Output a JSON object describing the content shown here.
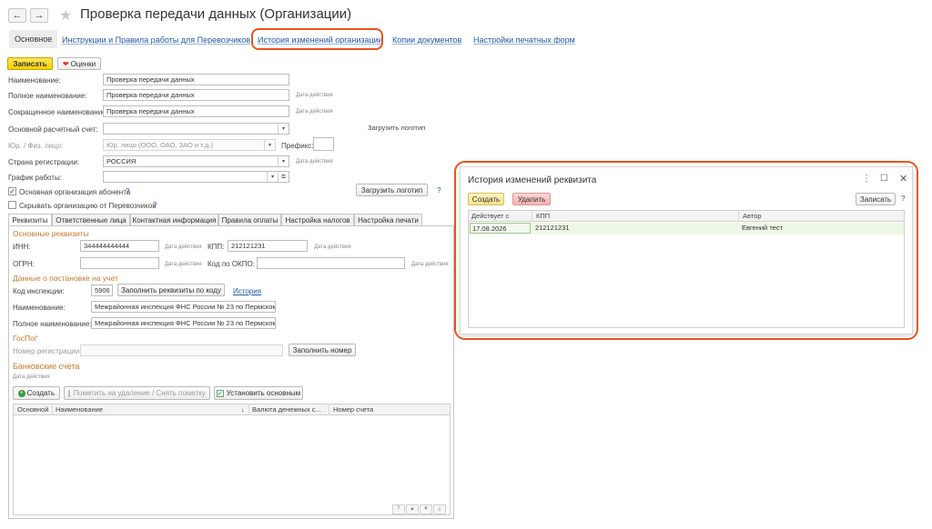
{
  "window": {
    "title": "Проверка передачи данных (Организации)",
    "back_icon": "←",
    "forward_icon": "→",
    "star_icon": "★"
  },
  "top_tabs": [
    {
      "label": "Основное"
    },
    {
      "label": "Инструкции и Правила работы для Перевозчиков"
    },
    {
      "label": "История изменений организации"
    },
    {
      "label": "Копии документов"
    },
    {
      "label": "Настройки печатных форм"
    }
  ],
  "toolbar": {
    "save_label": "Записать",
    "rating_label": "Оценки",
    "heart_icon": "❤"
  },
  "form": {
    "name_label": "Наименование:",
    "name_value": "Проверка передачи данных",
    "full_name_label": "Полное наименование:",
    "full_name_value": "Проверка передачи данных",
    "short_name_label": "Сокращенное наименование:",
    "short_name_value": "Проверка передачи данных",
    "valid_date": "Дата действия",
    "account_label": "Основной расчетный счет:",
    "account_value": "",
    "logo_label": "Загрузить логотип",
    "person_type_label": "Юр. / Физ. лицо:",
    "person_type_value": "Юр. лицо (ООО, ОАО, ЗАО и т.д.)",
    "prefix_label": "Префикс:",
    "prefix_value": "",
    "country_label": "Страна регистрации:",
    "country_value": "РОССИЯ",
    "schedule_label": "График работы:",
    "schedule_value": "",
    "main_org_label": "Основная организация абонента",
    "hide_org_label": "Скрывать организацию от Перевозчиков",
    "load_logo_button": "Загрузить логотип",
    "question": "?"
  },
  "sub_tabs": [
    {
      "label": "Реквизиты"
    },
    {
      "label": "Ответственные лица"
    },
    {
      "label": "Контактная информация"
    },
    {
      "label": "Правила оплаты"
    },
    {
      "label": "Настройка налогов"
    },
    {
      "label": "Настройка печати"
    }
  ],
  "requisites": {
    "section_main": "Основные реквизиты",
    "inn_label": "ИНН:",
    "inn_value": "344444444444",
    "kpp_label": "КПП:",
    "kpp_value": "212121231",
    "ogrn_label": "ОГРН:",
    "ogrn_value": "",
    "okpo_label": "Код по ОКПО:",
    "okpo_value": "",
    "valid_date": "Дата действия",
    "section_tax": "Данные о постановке на учет",
    "inspection_code_label": "Код инспекции:",
    "inspection_code_value": "5906",
    "fill_by_code_button": "Заполнить реквизиты по коду",
    "history_link": "История",
    "insp_name_label": "Наименование:",
    "insp_name_value": "Межрайонная инспекция ФНС России № 23 по Пермскому",
    "insp_full_label": "Полное наименование:",
    "insp_full_value": "Межрайонная инспекция ФНС России № 23 по Пермскому",
    "section_gos": "ГосПоґ",
    "reg_number_label": "Номер регистрации:",
    "reg_number_value": "",
    "fill_number_button": "Заполнить номер",
    "section_bank": "Банковские счета",
    "bank_valid_date": "Дата действия"
  },
  "bank_toolbar": {
    "create_label": "Создать",
    "mark_delete_label": "Пометить на удаление / Снять пометку",
    "set_main_label": "Установить основным"
  },
  "bank_table": {
    "headers": [
      "Основной",
      "Наименование",
      "↓",
      "Валюта денежных с...",
      "Номер счета"
    ]
  },
  "dialog": {
    "title": "История изменений реквизита",
    "menu_icon": "⋮",
    "maximize_icon": "☐",
    "close_icon": "✕",
    "create_label": "Создать",
    "delete_label": "Удалить",
    "save_label": "Записать",
    "question": "?",
    "headers": [
      "Действует с",
      "КПП",
      "Автор"
    ],
    "rows": [
      {
        "date": "17.08.2026",
        "kpp": "212121231",
        "author": "Евгений тест"
      }
    ]
  },
  "colors": {
    "accent": "#1f5aa6",
    "highlight": "#e8541c",
    "section": "#c5782e",
    "save": "#f7cf00"
  }
}
